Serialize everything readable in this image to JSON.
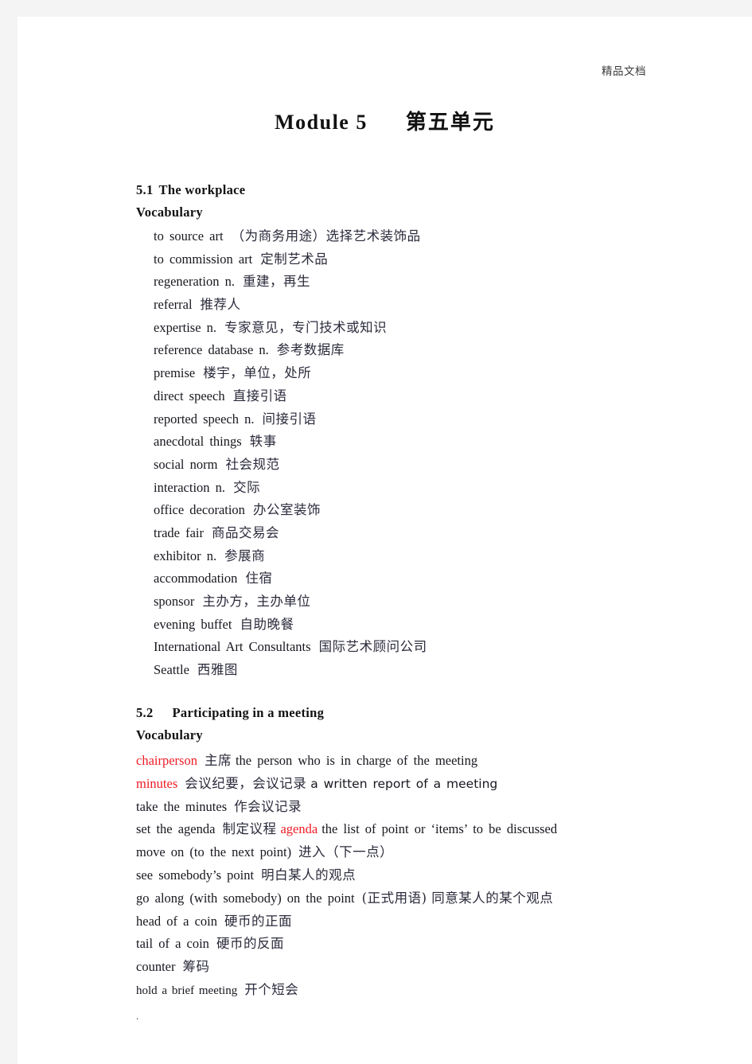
{
  "page": {
    "header_note": "精品文档",
    "title_latin": "Module 5",
    "title_cjk": "第五单元",
    "trailing_mark": "."
  },
  "section_5_1": {
    "number": "5.1",
    "title": "The  workplace",
    "subheading": "Vocabulary",
    "entries": [
      {
        "en": "to  source  art",
        "zh": "（为商务用途）选择艺术装饰品"
      },
      {
        "en": "to  commission  art",
        "zh": "定制艺术品"
      },
      {
        "en": "regeneration  n.",
        "zh": "重建，再生"
      },
      {
        "en": "referral",
        "zh": "推荐人"
      },
      {
        "en": "expertise  n.",
        "zh": "专家意见，专门技术或知识"
      },
      {
        "en": "reference  database  n.",
        "zh": "参考数据库"
      },
      {
        "en": "premise",
        "zh": "楼宇，单位，处所"
      },
      {
        "en": "direct  speech",
        "zh": "直接引语"
      },
      {
        "en": "reported  speech  n.",
        "zh": "间接引语"
      },
      {
        "en": "anecdotal  things",
        "zh": "轶事"
      },
      {
        "en": "social  norm",
        "zh": "社会规范"
      },
      {
        "en": "interaction  n.",
        "zh": "交际"
      },
      {
        "en": "office  decoration",
        "zh": "办公室装饰"
      },
      {
        "en": "trade  fair",
        "zh": "商品交易会"
      },
      {
        "en": "exhibitor  n.",
        "zh": "参展商"
      },
      {
        "en": "accommodation",
        "zh": "住宿"
      },
      {
        "en": "sponsor",
        "zh": "主办方，主办单位"
      },
      {
        "en": "evening  buffet",
        "zh": "自助晚餐"
      },
      {
        "en": "International  Art  Consultants",
        "zh": "国际艺术顾问公司"
      },
      {
        "en": "Seattle",
        "zh": "西雅图"
      }
    ]
  },
  "section_5_2": {
    "number": "5.2",
    "title": "Participating  in  a  meeting",
    "subheading": "Vocabulary",
    "highlight_color": "#ee1c25",
    "entries": [
      {
        "term": "chairperson",
        "term_highlighted": true,
        "zh": "主席",
        "definition": "the  person  who  is  in  charge  of  the  meeting",
        "definition_sans": false
      },
      {
        "term": "minutes",
        "term_highlighted": true,
        "zh": "会议纪要，会议记录",
        "definition": "a written report of a meeting",
        "definition_sans": true
      },
      {
        "term": "take  the  minutes",
        "term_highlighted": false,
        "zh": "作会议记录",
        "definition": "",
        "definition_sans": false
      },
      {
        "term": "set  the  agenda",
        "term_highlighted": false,
        "zh": "制定议程",
        "inline_red": "agenda",
        "definition": "the  list  of  point  or  ‘items’  to  be  discussed",
        "definition_sans": false
      },
      {
        "term": "move  on  (to  the  next  point)",
        "term_highlighted": false,
        "zh": "进入（下一点）",
        "definition": "",
        "definition_sans": false
      },
      {
        "term": "see  somebody’s  point",
        "term_highlighted": false,
        "zh": "明白某人的观点",
        "definition": "",
        "definition_sans": false
      },
      {
        "term": "go  along  (with  somebody)  on  the  point",
        "term_highlighted": false,
        "zh": "(正式用语)  同意某人的某个观点",
        "definition": "",
        "definition_sans": false
      },
      {
        "term": "head  of  a  coin",
        "term_highlighted": false,
        "zh": "硬币的正面",
        "definition": "",
        "definition_sans": false
      },
      {
        "term": "tail  of  a  coin",
        "term_highlighted": false,
        "zh": "硬币的反面",
        "definition": "",
        "definition_sans": false
      },
      {
        "term": "counter",
        "term_highlighted": false,
        "zh": "筹码",
        "definition": "",
        "definition_sans": false
      },
      {
        "term": "hold  a  brief  meeting",
        "term_highlighted": false,
        "zh": "开个短会",
        "definition": "",
        "definition_sans": false,
        "small": true
      }
    ]
  }
}
